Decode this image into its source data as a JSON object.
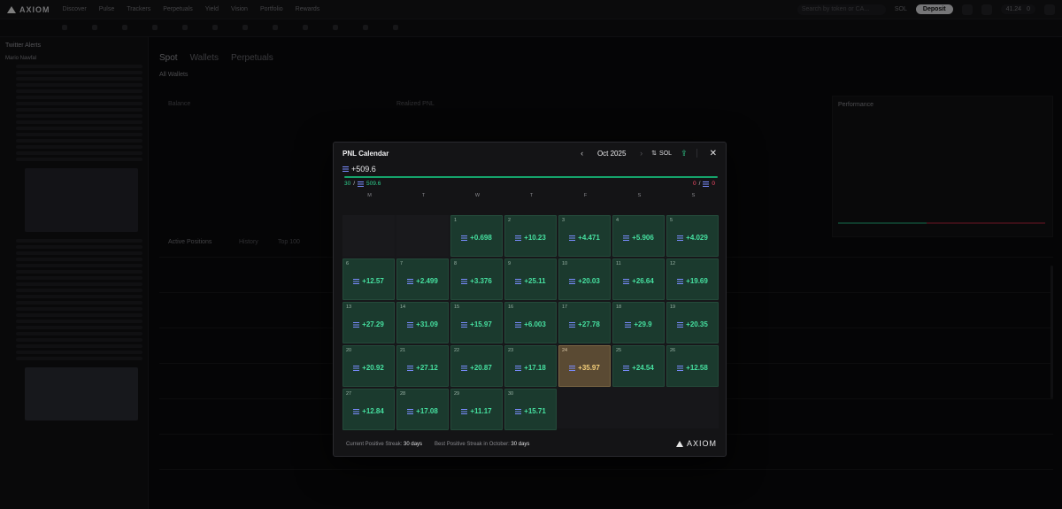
{
  "app": {
    "brand": "AXIOM",
    "nav": [
      "Discover",
      "Pulse",
      "Trackers",
      "Perpetuals",
      "Yield",
      "Vision",
      "Portfolio",
      "Rewards"
    ],
    "search_placeholder": "Search by token or CA...",
    "network": "SOL",
    "deposit_label": "Deposit",
    "wallet_balance": "41.24",
    "wallet_count": "0"
  },
  "left_panel": {
    "title": "Twitter Alerts",
    "author": "Mario Nawfal"
  },
  "main": {
    "tabs": [
      "Spot",
      "Wallets",
      "Perpetuals"
    ],
    "wallet_select": "All Wallets",
    "balance_label": "Balance",
    "realized_label": "Realized PNL",
    "performance_label": "Performance",
    "positions_tabs": [
      "Active Positions",
      "History",
      "Top 100"
    ]
  },
  "modal": {
    "title": "PNL Calendar",
    "month": "Oct 2025",
    "unit": "SOL",
    "total_pnl": "+509.6",
    "progress_fraction": 1.0,
    "positive_days": "30",
    "positive_total": "509.6",
    "negative_days": "0",
    "negative_total": "0",
    "weekdays": [
      "M",
      "T",
      "W",
      "T",
      "F",
      "S",
      "S"
    ],
    "leading_empty": 2,
    "today": 24,
    "days": [
      {
        "day": "1",
        "value": "+0.698"
      },
      {
        "day": "2",
        "value": "+10.23"
      },
      {
        "day": "3",
        "value": "+4.471"
      },
      {
        "day": "4",
        "value": "+5.906"
      },
      {
        "day": "5",
        "value": "+4.029"
      },
      {
        "day": "6",
        "value": "+12.57"
      },
      {
        "day": "7",
        "value": "+2.499"
      },
      {
        "day": "8",
        "value": "+3.376"
      },
      {
        "day": "9",
        "value": "+25.11"
      },
      {
        "day": "10",
        "value": "+20.03"
      },
      {
        "day": "11",
        "value": "+26.64"
      },
      {
        "day": "12",
        "value": "+19.69"
      },
      {
        "day": "13",
        "value": "+27.29"
      },
      {
        "day": "14",
        "value": "+31.09"
      },
      {
        "day": "15",
        "value": "+15.97"
      },
      {
        "day": "16",
        "value": "+6.003"
      },
      {
        "day": "17",
        "value": "+27.78"
      },
      {
        "day": "18",
        "value": "+29.9"
      },
      {
        "day": "19",
        "value": "+20.35"
      },
      {
        "day": "20",
        "value": "+20.92"
      },
      {
        "day": "21",
        "value": "+27.12"
      },
      {
        "day": "22",
        "value": "+20.87"
      },
      {
        "day": "23",
        "value": "+17.18"
      },
      {
        "day": "24",
        "value": "+35.97"
      },
      {
        "day": "25",
        "value": "+24.54"
      },
      {
        "day": "26",
        "value": "+12.58"
      },
      {
        "day": "27",
        "value": "+12.84"
      },
      {
        "day": "28",
        "value": "+17.08"
      },
      {
        "day": "29",
        "value": "+11.17"
      },
      {
        "day": "30",
        "value": "+15.71"
      }
    ],
    "footer": {
      "current_streak_label": "Current Positive Streak:",
      "current_streak_value": "30 days",
      "best_streak_label": "Best Positive Streak in October:",
      "best_streak_value": "30 days"
    },
    "brand": "AXIOM"
  },
  "colors": {
    "positive": "#46e0a0",
    "negative": "#ff4d6a",
    "today_highlight": "#f4cf7a",
    "cell_bg": "#1b3a2e"
  }
}
